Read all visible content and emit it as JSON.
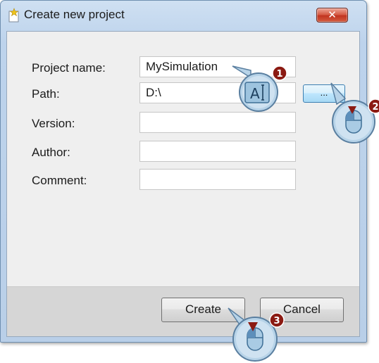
{
  "window": {
    "title": "Create new project",
    "close_glyph": "✕",
    "icon": "new-project-sparkle-icon"
  },
  "form": {
    "fields": [
      {
        "label": "Project name:",
        "value": "MySimulation"
      },
      {
        "label": "Path:",
        "value": "D:\\"
      },
      {
        "label": "Version:",
        "value": ""
      },
      {
        "label": "Author:",
        "value": ""
      },
      {
        "label": "Comment:",
        "value": ""
      }
    ],
    "browse_label": "..."
  },
  "buttons": {
    "create": "Create",
    "cancel": "Cancel"
  },
  "annotations": {
    "step1": "1",
    "step2": "2",
    "step3": "3",
    "text_cursor_glyph": "A",
    "step_color": "#8b1a12",
    "callout_fill": "#a8c8e0",
    "callout_stroke": "#5a7fa0"
  }
}
